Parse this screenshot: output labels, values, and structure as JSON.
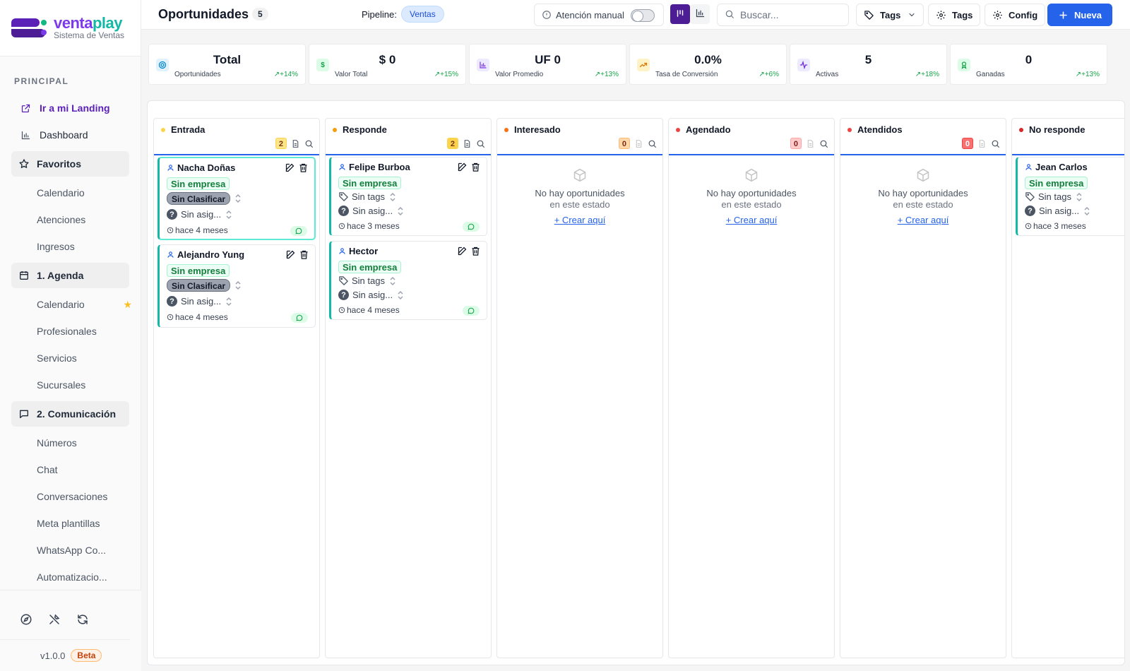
{
  "app": {
    "brand_main": "venta",
    "brand_accent": "play",
    "brand_sub": "Sistema de Ventas",
    "brand_color": "#7c3aed",
    "accent_color": "#14b8a6"
  },
  "sidebar": {
    "section_label": "PRINCIPAL",
    "landing": "Ir a mi Landing",
    "dashboard": "Dashboard",
    "favoritos": {
      "label": "Favoritos",
      "items": [
        "Calendario",
        "Atenciones",
        "Ingresos"
      ]
    },
    "agenda": {
      "label": "1. Agenda",
      "items": [
        "Calendario",
        "Profesionales",
        "Servicios",
        "Sucursales"
      ]
    },
    "comunicacion": {
      "label": "2. Comunicación",
      "items": [
        "Números",
        "Chat",
        "Conversaciones",
        "Meta plantillas",
        "WhatsApp Co...",
        "Automatizacio..."
      ]
    },
    "version": "v1.0.0",
    "beta": "Beta"
  },
  "header": {
    "title": "Oportunidades",
    "count": "5",
    "pipeline_label": "Pipeline:",
    "pipeline_value": "Ventas",
    "manual_label": "Atención manual",
    "search_placeholder": "Buscar...",
    "tags_filter": "Tags",
    "tags_manage": "Tags",
    "config": "Config",
    "new": "Nueva"
  },
  "stats": [
    {
      "value": "Total",
      "label": "Oportunidades",
      "trend": "+14%",
      "icon": "target-icon"
    },
    {
      "value": "$ 0",
      "label": "Valor Total",
      "trend": "+15%",
      "icon": "dollar-icon"
    },
    {
      "value": "UF 0",
      "label": "Valor Promedio",
      "trend": "+13%",
      "icon": "bar-chart-icon"
    },
    {
      "value": "0.0%",
      "label": "Tasa de Conversión",
      "trend": "+6%",
      "icon": "trending-up-icon"
    },
    {
      "value": "5",
      "label": "Activas",
      "trend": "+18%",
      "icon": "activity-icon"
    },
    {
      "value": "0",
      "label": "Ganadas",
      "trend": "+13%",
      "icon": "award-icon"
    }
  ],
  "columns": [
    {
      "title": "Entrada",
      "count": "2",
      "dot": "#fcd34d",
      "cards": [
        {
          "name": "Nacha Doñas",
          "company": "Sin empresa",
          "classify": "Sin Clasificar",
          "assign": "Sin asig...",
          "time": "hace 4 meses"
        },
        {
          "name": "Alejandro Yung",
          "company": "Sin empresa",
          "classify": "Sin Clasificar",
          "assign": "Sin asig...",
          "time": "hace 4 meses"
        }
      ]
    },
    {
      "title": "Responde",
      "count": "2",
      "dot": "#f59e0b",
      "cards": [
        {
          "name": "Felipe Burboa",
          "company": "Sin empresa",
          "tags": "Sin tags",
          "assign": "Sin asig...",
          "time": "hace 3 meses"
        },
        {
          "name": "Hector",
          "company": "Sin empresa",
          "tags": "Sin tags",
          "assign": "Sin asig...",
          "time": "hace 4 meses"
        }
      ]
    },
    {
      "title": "Interesado",
      "count": "0",
      "dot": "#f97316",
      "empty1": "No hay oportunidades",
      "empty2": "en este estado",
      "create": "+ Crear aquí"
    },
    {
      "title": "Agendado",
      "count": "0",
      "dot": "#ef4444",
      "empty1": "No hay oportunidades",
      "empty2": "en este estado",
      "create": "+ Crear aquí"
    },
    {
      "title": "Atendidos",
      "count": "0",
      "dot": "#ef4444",
      "empty1": "No hay oportunidades",
      "empty2": "en este estado",
      "create": "+ Crear aquí"
    },
    {
      "title": "No responde",
      "dot": "#dc2626",
      "cards": [
        {
          "name": "Jean Carlos",
          "company": "Sin empresa",
          "tags": "Sin tags",
          "assign": "Sin asig...",
          "time": "hace 3 meses"
        }
      ]
    }
  ]
}
